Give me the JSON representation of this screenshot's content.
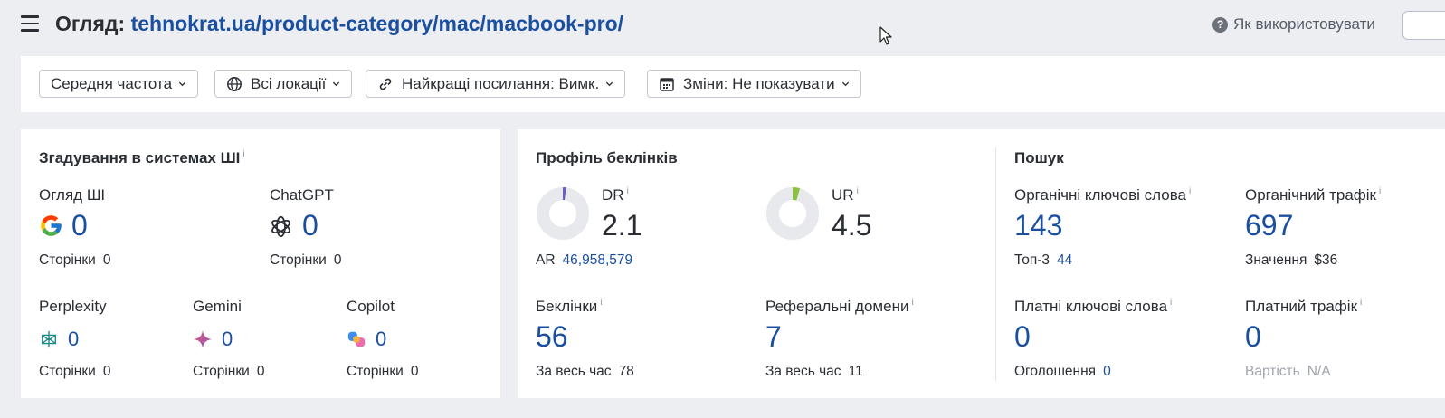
{
  "header": {
    "title_prefix": "Огляд: ",
    "title_url": "tehnokrat.ua/product-category/mac/macbook-pro/",
    "help_label": "Як використовувати"
  },
  "filters": [
    {
      "label": "Середня частота",
      "icon": "none"
    },
    {
      "label": "Всі локації",
      "icon": "globe-icon"
    },
    {
      "label": "Найкращі посилання: Вимк.",
      "icon": "link-icon"
    },
    {
      "label": "Зміни: Не показувати",
      "icon": "calendar-icon"
    }
  ],
  "ai": {
    "title": "Згадування в системах ШІ",
    "info": "i",
    "pages_label": "Сторінки",
    "items": [
      {
        "name": "Огляд ШІ",
        "value": "0",
        "pages": "0",
        "icon": "google-icon"
      },
      {
        "name": "ChatGPT",
        "value": "0",
        "pages": "0",
        "icon": "chatgpt-icon"
      },
      {
        "name": "Perplexity",
        "value": "0",
        "pages": "0",
        "icon": "perplexity-icon"
      },
      {
        "name": "Gemini",
        "value": "0",
        "pages": "0",
        "icon": "gemini-icon"
      },
      {
        "name": "Copilot",
        "value": "0",
        "pages": "0",
        "icon": "copilot-icon"
      }
    ]
  },
  "backlinks": {
    "title": "Профіль беклінків",
    "dr": {
      "label": "DR",
      "value": "2.1",
      "fraction": 0.021,
      "color": "#6b5cc4"
    },
    "ar": {
      "label": "AR",
      "value": "46,958,579"
    },
    "ur": {
      "label": "UR",
      "value": "4.5",
      "fraction": 0.045,
      "color": "#8cc043"
    },
    "backlinks": {
      "label": "Беклінки",
      "value": "56",
      "all_time_label": "За весь час",
      "all_time_value": "78"
    },
    "ref_domains": {
      "label": "Реферальні домени",
      "value": "7",
      "all_time_label": "За весь час",
      "all_time_value": "11"
    }
  },
  "search": {
    "title": "Пошук",
    "organic_keywords": {
      "label": "Органічні ключові слова",
      "value": "143",
      "sub_label": "Топ-3",
      "sub_value": "44"
    },
    "organic_traffic": {
      "label": "Органічний трафік",
      "value": "697",
      "sub_label": "Значення",
      "sub_value": "$36"
    },
    "paid_keywords": {
      "label": "Платні ключові слова",
      "value": "0",
      "sub_label": "Оголошення",
      "sub_value": "0"
    },
    "paid_traffic": {
      "label": "Платний трафік",
      "value": "0",
      "sub_label": "Вартість",
      "sub_value": "N/A"
    }
  },
  "colors": {
    "link": "#1a4fa0",
    "text": "#2a2e34",
    "bg": "#eceef2"
  }
}
